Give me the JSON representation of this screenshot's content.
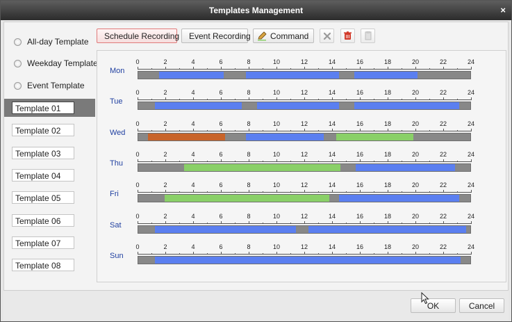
{
  "window": {
    "title": "Templates Management",
    "close_glyph": "×"
  },
  "template_types": [
    {
      "label": "All-day Template"
    },
    {
      "label": "Weekday Template"
    },
    {
      "label": "Event Template"
    }
  ],
  "templates": [
    "Template 01",
    "Template 02",
    "Template 03",
    "Template 04",
    "Template 05",
    "Template 06",
    "Template 07",
    "Template 08"
  ],
  "selected_template_index": 0,
  "toolbar": {
    "schedule_label": "Schedule Recording",
    "event_label": "Event Recording",
    "command_label": "Command",
    "delete_icon": "x-delete-icon",
    "trash_icon": "trash-icon",
    "copy_icon": "copy-icon"
  },
  "colors": {
    "schedule": "#5b7ff0",
    "event": "#c8642a",
    "command": "#8ad068",
    "empty": "#888888"
  },
  "hour_ticks": [
    "0",
    "2",
    "4",
    "6",
    "8",
    "10",
    "12",
    "14",
    "16",
    "18",
    "20",
    "22",
    "24"
  ],
  "schedule": [
    {
      "day": "Mon",
      "segments": [
        {
          "start": 1.5,
          "end": 6.2,
          "type": "schedule"
        },
        {
          "start": 7.8,
          "end": 14.5,
          "type": "schedule"
        },
        {
          "start": 15.6,
          "end": 20.2,
          "type": "schedule"
        }
      ]
    },
    {
      "day": "Tue",
      "segments": [
        {
          "start": 1.2,
          "end": 7.5,
          "type": "schedule"
        },
        {
          "start": 8.6,
          "end": 14.5,
          "type": "schedule"
        },
        {
          "start": 15.6,
          "end": 23.2,
          "type": "schedule"
        }
      ]
    },
    {
      "day": "Wed",
      "segments": [
        {
          "start": 0.7,
          "end": 6.3,
          "type": "event"
        },
        {
          "start": 7.8,
          "end": 13.4,
          "type": "schedule"
        },
        {
          "start": 14.3,
          "end": 19.9,
          "type": "command"
        }
      ]
    },
    {
      "day": "Thu",
      "segments": [
        {
          "start": 3.3,
          "end": 14.6,
          "type": "command"
        },
        {
          "start": 15.7,
          "end": 22.9,
          "type": "schedule"
        }
      ]
    },
    {
      "day": "Fri",
      "segments": [
        {
          "start": 1.9,
          "end": 13.8,
          "type": "command"
        },
        {
          "start": 14.5,
          "end": 23.2,
          "type": "schedule"
        }
      ]
    },
    {
      "day": "Sat",
      "segments": [
        {
          "start": 1.2,
          "end": 11.4,
          "type": "schedule"
        },
        {
          "start": 12.3,
          "end": 23.7,
          "type": "schedule"
        }
      ]
    },
    {
      "day": "Sun",
      "segments": [
        {
          "start": 1.2,
          "end": 23.3,
          "type": "schedule"
        }
      ]
    }
  ],
  "buttons": {
    "ok": "OK",
    "cancel": "Cancel"
  }
}
